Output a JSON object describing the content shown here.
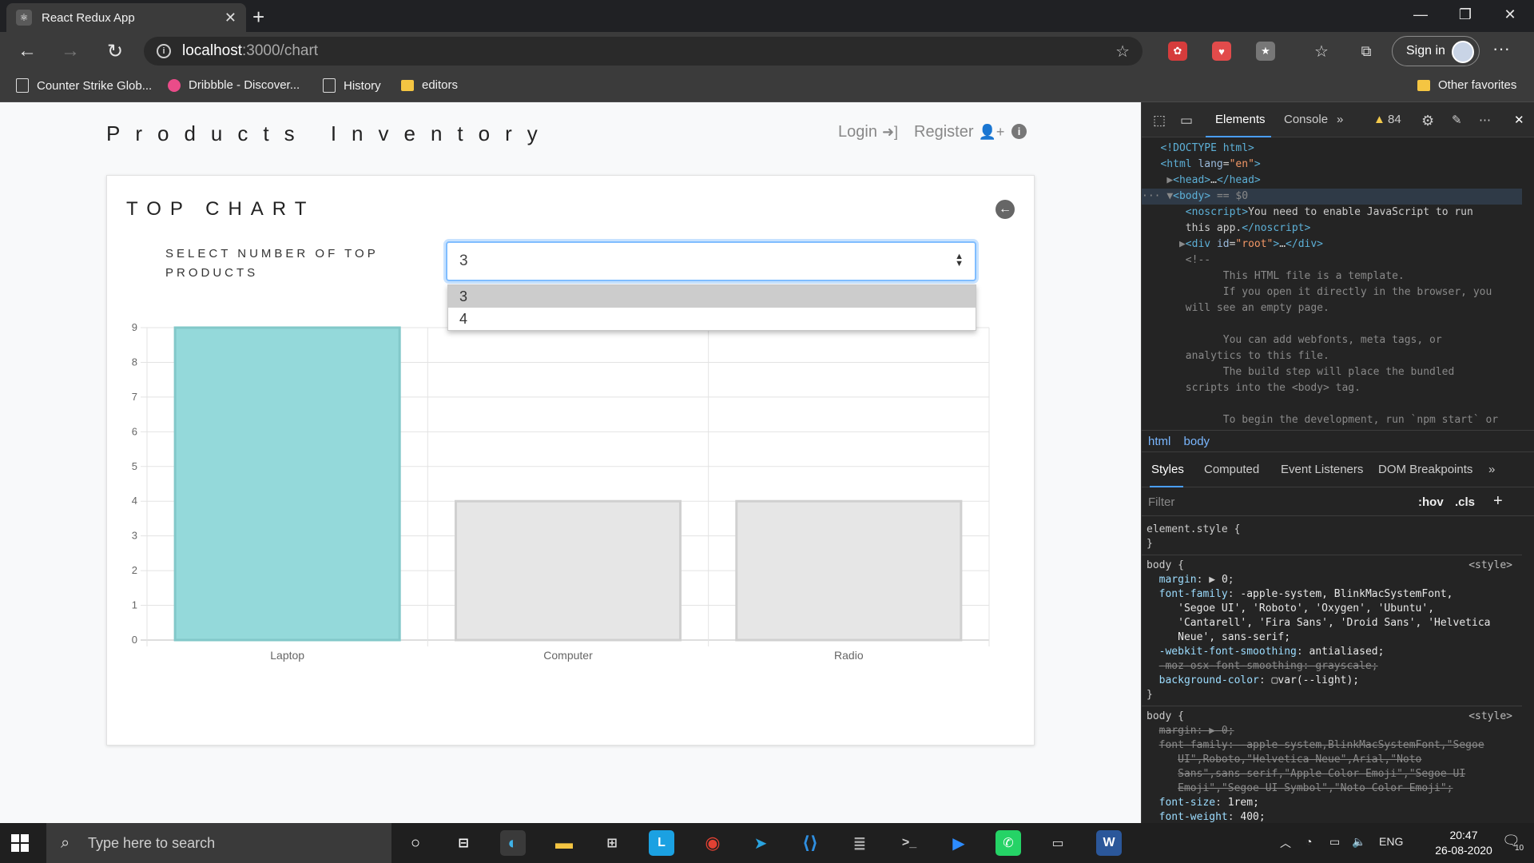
{
  "browser": {
    "tab_title": "React Redux App",
    "url_host": "localhost",
    "url_path": ":3000/chart",
    "signin_label": "Sign in",
    "bookmarks": [
      {
        "label": "Counter Strike Glob...",
        "icon": "page-icon"
      },
      {
        "label": "Dribbble - Discover...",
        "icon": "dribbble-icon"
      },
      {
        "label": "History",
        "icon": "page-icon"
      },
      {
        "label": "editors",
        "icon": "folder-icon"
      }
    ],
    "other_favorites": "Other favorites"
  },
  "app": {
    "brand": "Products Inventory",
    "nav": {
      "login": "Login",
      "register": "Register"
    },
    "card_title": "TOP CHART",
    "select_label": "SELECT NUMBER OF TOP PRODUCTS",
    "select_value": "3",
    "dropdown_options": [
      "3",
      "4"
    ]
  },
  "chart_data": {
    "type": "bar",
    "categories": [
      "Laptop",
      "Computer",
      "Radio"
    ],
    "values": [
      9,
      4,
      4
    ],
    "ylim": [
      0,
      9
    ],
    "yticks": [
      0,
      1,
      2,
      3,
      4,
      5,
      6,
      7,
      8,
      9
    ],
    "grid": true,
    "colors": [
      "#94d9da",
      "#e6e6e6",
      "#e6e6e6"
    ],
    "border_colors": [
      "#82c8c9",
      "#d0d0d0",
      "#d0d0d0"
    ]
  },
  "devtools": {
    "tabs": [
      "Elements",
      "Console"
    ],
    "warning_count": "84",
    "breadcrumbs": [
      "html",
      "body"
    ],
    "style_tabs": [
      "Styles",
      "Computed",
      "Event Listeners",
      "DOM Breakpoints"
    ],
    "filter_placeholder": "Filter",
    "hov": ":hov",
    "cls": ".cls"
  },
  "taskbar": {
    "search_placeholder": "Type here to search",
    "lang": "ENG",
    "time": "20:47",
    "date": "26-08-2020",
    "notif_count": "10"
  }
}
